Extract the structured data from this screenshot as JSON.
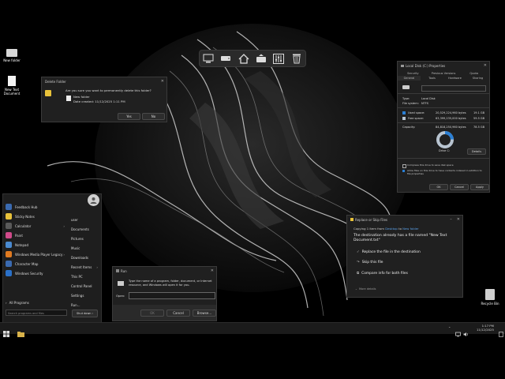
{
  "desktop": {
    "icons": [
      {
        "label": "New folder",
        "icon": "folder-icon"
      },
      {
        "label": "New Text Document",
        "icon": "text-document-icon"
      },
      {
        "label": "Recycle Bin",
        "icon": "recycle-bin-icon"
      }
    ]
  },
  "dock": {
    "items": [
      "computer-icon",
      "drive-icon",
      "home-icon",
      "eject-drive-icon",
      "equalizer-icon",
      "trash-icon"
    ]
  },
  "delete_dialog": {
    "title": "Delete Folder",
    "question": "Are you sure you want to permanently delete this folder?",
    "item_name": "New folder",
    "item_date": "Date created: 11/12/2025 1:11 PM",
    "yes_label": "Yes",
    "no_label": "No"
  },
  "properties": {
    "title": "Local Disk (C:) Properties",
    "tabs_row1": [
      "Security",
      "Previous Versions",
      "Quota"
    ],
    "tabs_row2": [
      "General",
      "Tools",
      "Hardware",
      "Sharing"
    ],
    "drive_name": "",
    "type_label": "Type:",
    "type_value": "Local Disk",
    "fs_label": "File system:",
    "fs_value": "NTFS",
    "used_label": "Used space:",
    "used_bytes": "20,529,224,960 bytes",
    "used_gb": "19.1 GB",
    "free_label": "Free space:",
    "free_bytes": "63,399,235,000 bytes",
    "free_gb": "59.5 GB",
    "capacity_label": "Capacity:",
    "capacity_bytes": "84,818,250,960 bytes",
    "capacity_gb": "78.5 GB",
    "drive_caption": "Drive C:",
    "details_label": "Details",
    "compress_label": "Compress this drive to save disk space",
    "index_label": "Allow files on this drive to have contents indexed in addition to file properties",
    "ok_label": "OK",
    "cancel_label": "Cancel",
    "apply_label": "Apply",
    "used_fraction": 0.24,
    "used_color": "#2a7fd4",
    "free_color": "#b8c4d0"
  },
  "replace_dialog": {
    "title": "Replace or Skip Files",
    "copying_prefix": "Copying 1 item from",
    "copying_from": "Desktop",
    "copying_to_word": "to",
    "copying_to": "New folder",
    "message": "The destination already has a file named \"New Text Document.txt\"",
    "option1": "Replace the file in the destination",
    "option2": "Skip this file",
    "option3": "Compare info for both files",
    "more_details": "More details"
  },
  "run_dialog": {
    "title": "Run",
    "description": "Type the name of a program, folder, document, or Internet resource, and Windows will open it for you.",
    "open_label": "Open:",
    "open_value": "",
    "ok_label": "OK",
    "cancel_label": "Cancel",
    "browse_label": "Browse..."
  },
  "start_menu": {
    "pinned": [
      {
        "label": "Feedback Hub",
        "color": "#3a6ab0",
        "arrow": false
      },
      {
        "label": "Sticky Notes",
        "color": "#e8c23a",
        "arrow": false
      },
      {
        "label": "Calculator",
        "color": "#5a5a5a",
        "arrow": true
      },
      {
        "label": "Paint",
        "color": "#d04a8a",
        "arrow": false
      },
      {
        "label": "Notepad",
        "color": "#4a8ad0",
        "arrow": false
      },
      {
        "label": "Windows Media Player Legacy",
        "color": "#e07a20",
        "arrow": true
      },
      {
        "label": "Character Map",
        "color": "#3a6ab0",
        "arrow": false
      },
      {
        "label": "Windows Security",
        "color": "#2a70c8",
        "arrow": false
      }
    ],
    "all_programs": "All Programs",
    "search_placeholder": "Search programs and files",
    "shutdown_label": "Shut down",
    "right_items": [
      {
        "label": "user",
        "arrow": false
      },
      {
        "label": "Documents",
        "arrow": false
      },
      {
        "label": "Pictures",
        "arrow": false
      },
      {
        "label": "Music",
        "arrow": false
      },
      {
        "label": "Downloads",
        "arrow": false
      },
      {
        "label": "Recent Items",
        "arrow": true
      },
      {
        "label": "This PC",
        "arrow": false
      },
      {
        "label": "Control Panel",
        "arrow": false
      },
      {
        "label": "Settings",
        "arrow": false
      },
      {
        "label": "Run...",
        "arrow": false
      }
    ]
  },
  "taskbar": {
    "time": "1:17 PM",
    "date": "11/12/2025"
  }
}
